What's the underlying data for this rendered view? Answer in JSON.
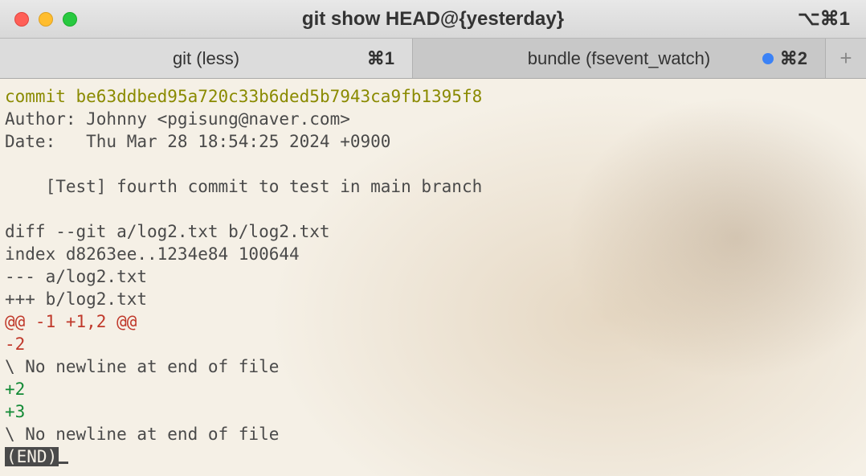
{
  "window": {
    "title": "git show HEAD@{yesterday}",
    "shortcut": "⌥⌘1"
  },
  "tabs": [
    {
      "label": "git (less)",
      "shortcut": "⌘1",
      "active": true,
      "has_dot": false
    },
    {
      "label": "bundle (fsevent_watch)",
      "shortcut": "⌘2",
      "active": false,
      "has_dot": true
    }
  ],
  "terminal": {
    "commit_label": "commit",
    "commit_hash": "be63ddbed95a720c33b6ded5b7943ca9fb1395f8",
    "author_line": "Author: Johnny <pgisung@naver.com>",
    "date_line": "Date:   Thu Mar 28 18:54:25 2024 +0900",
    "message": "    [Test] fourth commit to test in main branch",
    "diff_header": "diff --git a/log2.txt b/log2.txt",
    "index_line": "index d8263ee..1234e84 100644",
    "minus_file": "--- a/log2.txt",
    "plus_file": "+++ b/log2.txt",
    "hunk": "@@ -1 +1,2 @@",
    "del1": "-2",
    "nnl1": "\\ No newline at end of file",
    "add1": "+2",
    "add2": "+3",
    "nnl2": "\\ No newline at end of file",
    "end": "(END)"
  }
}
